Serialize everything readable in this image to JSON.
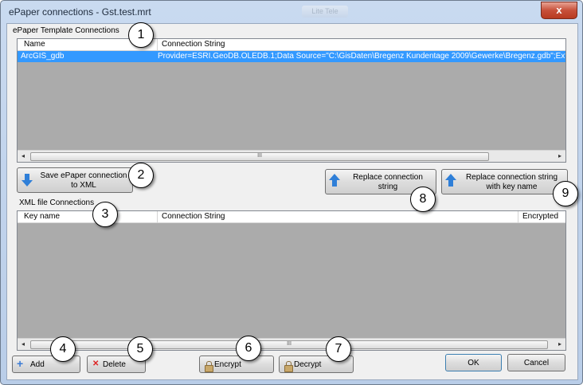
{
  "window": {
    "title": "ePaper connections - Gst.test.mrt",
    "blurred_tab": "Lite Tele",
    "close_label": "x"
  },
  "template_connections": {
    "group_label": "ePaper Template Connections",
    "columns": [
      "Name",
      "Connection String"
    ],
    "rows": [
      {
        "name": "ArcGIS_gdb",
        "connection_string": "Provider=ESRI.GeoDB.OLEDB.1;Data Source=\"C:\\GisDaten\\Bregenz Kundentage 2009\\Gewerke\\Bregenz.gdb\";Extended"
      }
    ],
    "scroll_left": "◂",
    "scroll_right": "▸",
    "scroll_thumb": "III"
  },
  "xml_connections": {
    "group_label": "XML file Connections",
    "columns": [
      "Key name",
      "Connection String",
      "Encrypted"
    ],
    "scroll_left": "◂",
    "scroll_right": "▸",
    "scroll_thumb": "III"
  },
  "buttons": {
    "save_xml": [
      "Save ePaper connection",
      "to XML"
    ],
    "replace": [
      "Replace connection",
      "string"
    ],
    "replace_key": [
      "Replace connection string",
      "with key name"
    ],
    "add": "Add",
    "delete": "Delete",
    "encrypt": "Encrypt",
    "decrypt": "Decrypt",
    "ok": "OK",
    "cancel": "Cancel"
  },
  "icons": {
    "add": "+",
    "delete": "✕"
  },
  "callouts": [
    "1",
    "2",
    "3",
    "4",
    "5",
    "6",
    "7",
    "8",
    "9"
  ],
  "colors": {
    "selection": "#3399ff",
    "arrow": "#2f7fd8",
    "grid_background": "#ababab"
  }
}
